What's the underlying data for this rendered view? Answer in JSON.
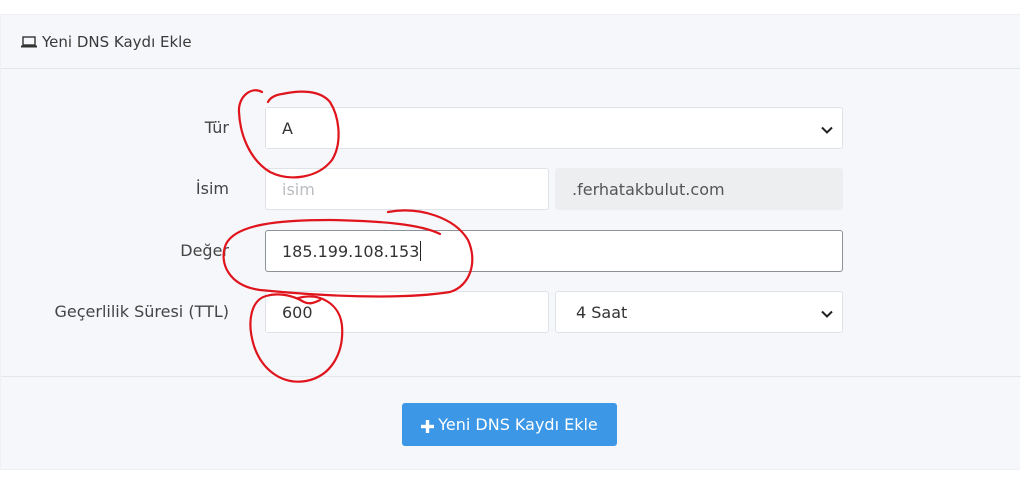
{
  "panel": {
    "title": "Yeni DNS Kaydı Ekle",
    "title_icon": "laptop-icon"
  },
  "form": {
    "type": {
      "label": "Tür",
      "value": "A"
    },
    "name": {
      "label": "İsim",
      "placeholder": "isim",
      "value": "",
      "suffix": ".ferhatakbulut.com"
    },
    "value": {
      "label": "Değer",
      "value": "185.199.108.153"
    },
    "ttl": {
      "label": "Geçerlilik Süresi (TTL)",
      "value": "600",
      "unit": "4 Saat"
    }
  },
  "actions": {
    "submit_label": "Yeni DNS Kaydı Ekle",
    "submit_icon": "plus-icon",
    "submit_color": "#3c97e6"
  },
  "annotations": {
    "color": "#e0141c",
    "marks": [
      "type-value-circle",
      "value-field-circle",
      "ttl-value-circle"
    ]
  }
}
